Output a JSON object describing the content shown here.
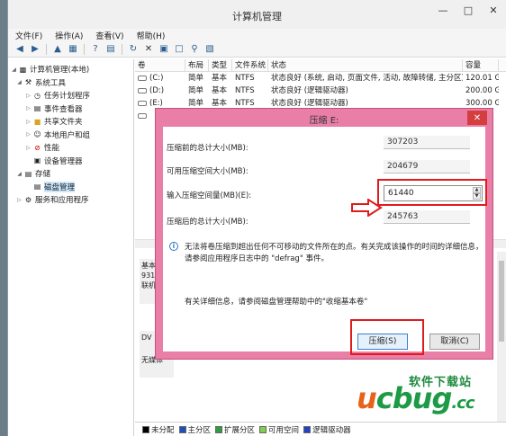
{
  "window": {
    "title": "计算机管理"
  },
  "menu": [
    "文件(F)",
    "操作(A)",
    "查看(V)",
    "帮助(H)"
  ],
  "tree": [
    {
      "label": "计算机管理(本地)",
      "indent": 0,
      "icon": "computer-icon"
    },
    {
      "label": "系统工具",
      "indent": 1,
      "icon": "tools-icon"
    },
    {
      "label": "任务计划程序",
      "indent": 2,
      "icon": "clock-icon"
    },
    {
      "label": "事件查看器",
      "indent": 2,
      "icon": "event-viewer-icon"
    },
    {
      "label": "共享文件夹",
      "indent": 2,
      "icon": "folder-icon"
    },
    {
      "label": "本地用户和组",
      "indent": 2,
      "icon": "users-icon"
    },
    {
      "label": "性能",
      "indent": 2,
      "icon": "performance-icon"
    },
    {
      "label": "设备管理器",
      "indent": 2,
      "icon": "device-manager-icon"
    },
    {
      "label": "存储",
      "indent": 1,
      "icon": "storage-icon"
    },
    {
      "label": "磁盘管理",
      "indent": 2,
      "icon": "disk-icon"
    },
    {
      "label": "服务和应用程序",
      "indent": 1,
      "icon": "services-icon"
    }
  ],
  "table": {
    "headers": [
      "卷",
      "布局",
      "类型",
      "文件系统",
      "状态",
      "容量"
    ],
    "rows": [
      [
        "(C:)",
        "简单",
        "基本",
        "NTFS",
        "状态良好 (系统, 启动, 页面文件, 活动, 故障转储, 主分区)",
        "120.01 G"
      ],
      [
        "(D:)",
        "简单",
        "基本",
        "NTFS",
        "状态良好 (逻辑驱动器)",
        "200.00 G"
      ],
      [
        "(E:)",
        "简单",
        "基本",
        "NTFS",
        "状态良好 (逻辑驱动器)",
        "300.00 G"
      ],
      [
        "",
        "",
        "",
        "",
        "",
        ""
      ]
    ]
  },
  "disk_labels": {
    "disk0": [
      "基本",
      "931",
      "联机"
    ],
    "dvd": [
      "DV",
      "无媒体"
    ]
  },
  "legend": [
    {
      "label": "未分配",
      "color": "#000000"
    },
    {
      "label": "主分区",
      "color": "#1f4fb8"
    },
    {
      "label": "扩展分区",
      "color": "#2e9e3a"
    },
    {
      "label": "可用空间",
      "color": "#7fcf4f"
    },
    {
      "label": "逻辑驱动器",
      "color": "#2143c4"
    }
  ],
  "dialog": {
    "title": "压缩 E:",
    "total_before_label": "压缩前的总计大小(MB):",
    "total_before_value": "307203",
    "available_label": "可用压缩空间大小(MB):",
    "available_value": "204679",
    "input_label": "输入压缩空间量(MB)(E):",
    "input_value": "61440",
    "total_after_label": "压缩后的总计大小(MB):",
    "total_after_value": "245763",
    "info_text": "无法将卷压缩到超出任何不可移动的文件所在的点。有关完成该操作的时间的详细信息，请参阅应用程序日志中的 \"defrag\" 事件。",
    "help_text": "有关详细信息，请参阅磁盘管理帮助中的\"收缩基本卷\"",
    "ok_label": "压缩(S)",
    "cancel_label": "取消(C)"
  },
  "watermark": {
    "top": "软件下载站",
    "brand_u": "u",
    "brand_rest": "cbug",
    "brand_tld": ".cc"
  },
  "colors": {
    "dialog_frame": "#e97fa7",
    "highlight": "#e01b1b",
    "close_button": "#d53e3e"
  }
}
